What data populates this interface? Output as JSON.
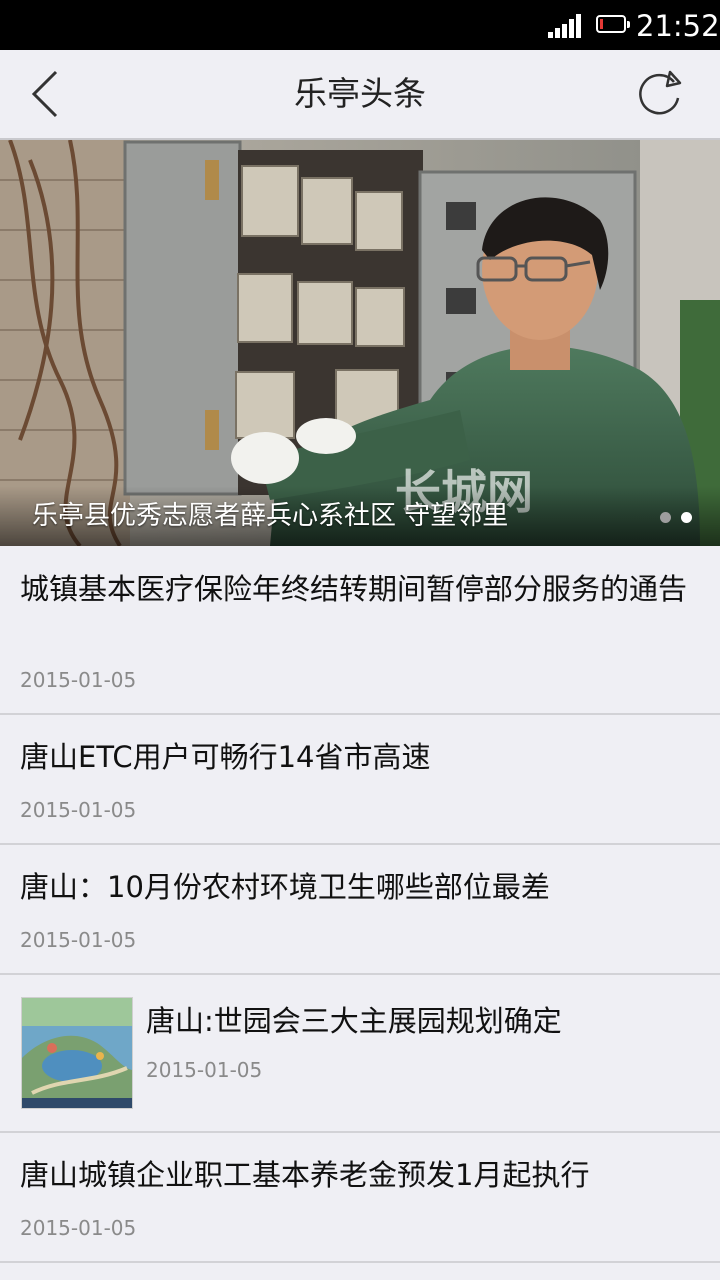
{
  "status_bar": {
    "time": "21:52"
  },
  "nav": {
    "title": "乐亭头条",
    "back_icon": "back-arrow-icon",
    "refresh_icon": "refresh-icon"
  },
  "banner": {
    "caption": "乐亭县优秀志愿者薛兵心系社区 守望邻里",
    "watermark": "长城网",
    "slide_count": 2,
    "active_slide": 2
  },
  "news": [
    {
      "title": "城镇基本医疗保险年终结转期间暂停部分服务的通告",
      "date": "2015-01-05"
    },
    {
      "title": "唐山ETC用户可畅行14省市高速",
      "date": "2015-01-05"
    },
    {
      "title": "唐山：10月份农村环境卫生哪些部位最差",
      "date": "2015-01-05"
    },
    {
      "title": "唐山:世园会三大主展园规划确定",
      "date": "2015-01-05",
      "has_thumbnail": true
    },
    {
      "title": "唐山城镇企业职工基本养老金预发1月起执行",
      "date": "2015-01-05"
    }
  ]
}
